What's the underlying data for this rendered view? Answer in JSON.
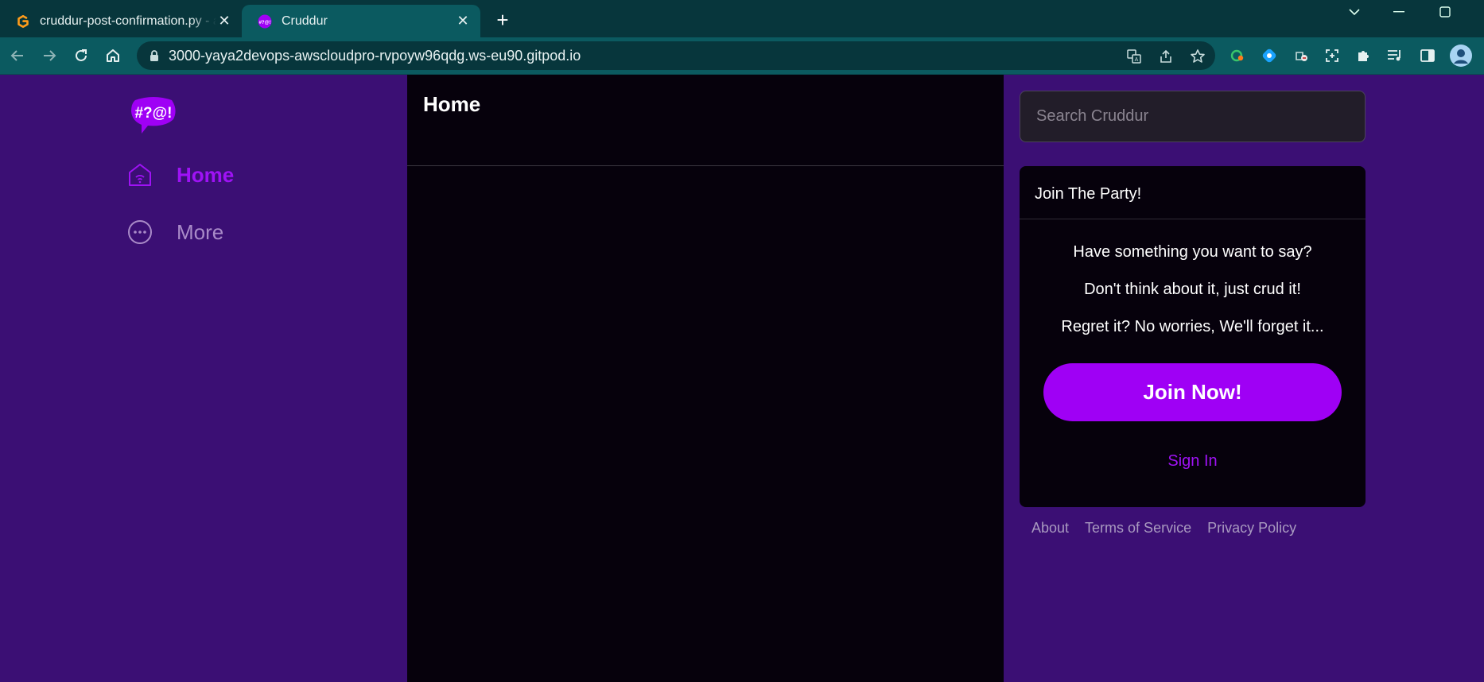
{
  "browser": {
    "tabs": [
      {
        "title": "cruddur-post-confirmation.py - a",
        "favicon": "gitpod-favicon"
      },
      {
        "title": "Cruddur",
        "favicon": "cruddur-favicon"
      }
    ],
    "url": "3000-yaya2devops-awscloudpro-rvpoyw96qdg.ws-eu90.gitpod.io"
  },
  "sidebar": {
    "logo_text": "#?@!",
    "items": [
      {
        "label": "Home",
        "icon": "home-icon",
        "active": true
      },
      {
        "label": "More",
        "icon": "more-icon",
        "active": false
      }
    ]
  },
  "main": {
    "title": "Home"
  },
  "search": {
    "placeholder": "Search Cruddur"
  },
  "join": {
    "title": "Join The Party!",
    "lines": [
      "Have something you want to say?",
      "Don't think about it, just crud it!",
      "Regret it? No worries, We'll forget it..."
    ],
    "button": "Join Now!",
    "signin": "Sign In"
  },
  "footer": {
    "links": [
      "About",
      "Terms of Service",
      "Privacy Policy"
    ]
  },
  "colors": {
    "page_bg": "#3b0f74",
    "accent": "#9f00f5",
    "content_bg": "#06010c",
    "browser_frame": "#07363c",
    "browser_toolbar": "#0b5a60"
  }
}
